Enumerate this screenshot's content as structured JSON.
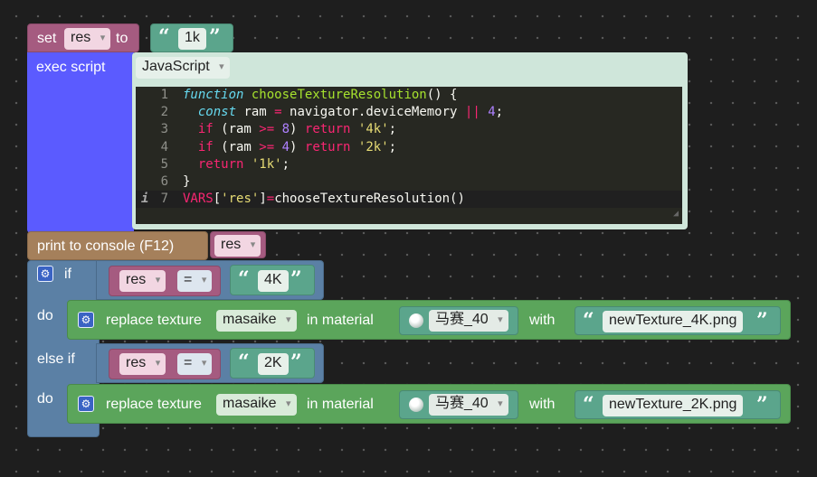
{
  "set_block": {
    "set_label": "set",
    "var": "res",
    "to_label": "to",
    "value": "1k"
  },
  "exec_block": {
    "label": "exec script",
    "language": "JavaScript",
    "code_lines": [
      "function chooseTextureResolution() {",
      "  const ram = navigator.deviceMemory || 4;",
      "  if (ram >= 8) return '4k';",
      "  if (ram >= 4) return '2k';",
      "  return '1k';",
      "}",
      "VARS['res']=chooseTextureResolution()"
    ],
    "line_numbers": [
      "1",
      "2",
      "3",
      "4",
      "5",
      "6",
      "7"
    ],
    "info_marker": "i"
  },
  "print_block": {
    "label": "print to console (F12)",
    "var": "res"
  },
  "if_block": {
    "if_label": "if",
    "do_label": "do",
    "elseif_label": "else if",
    "do2_label": "do",
    "cond1": {
      "var": "res",
      "op": "=",
      "value": "4K"
    },
    "cond2": {
      "var": "res",
      "op": "=",
      "value": "2K"
    },
    "replace1": {
      "label": "replace texture",
      "texture": "masaike",
      "in_material_label": "in material",
      "material": "马赛_40",
      "with_label": "with",
      "file": "newTexture_4K.png"
    },
    "replace2": {
      "label": "replace texture",
      "texture": "masaike",
      "in_material_label": "in material",
      "material": "马赛_40",
      "with_label": "with",
      "file": "newTexture_2K.png"
    }
  },
  "colors": {
    "variable": "#a55b80",
    "text": "#5ba58c",
    "script": "#5b5bff",
    "print": "#a5805b",
    "logic": "#5b80a5",
    "action": "#5ba55b"
  }
}
